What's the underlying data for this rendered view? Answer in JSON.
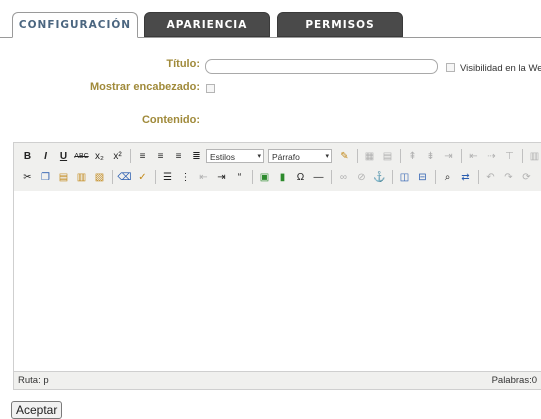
{
  "tabs": [
    {
      "label": "CONFIGURACIÓN",
      "active": true
    },
    {
      "label": "APARIENCIA",
      "active": false
    },
    {
      "label": "PERMISOS",
      "active": false
    }
  ],
  "form": {
    "title_label": "Título:",
    "title_value": "",
    "visibility_label": "Visibilidad en la Web",
    "show_header_label": "Mostrar encabezado:",
    "content_label": "Contenido:"
  },
  "editor": {
    "styles_select": "Estilos",
    "format_select": "Párrafo",
    "toolbar_row1": [
      "bold-icon",
      "italic-icon",
      "underline-icon",
      "strikethrough-icon",
      "subscript-icon",
      "superscript-icon",
      "align-left-icon",
      "align-center-icon",
      "align-right-icon",
      "align-justify-icon"
    ],
    "toolbar_row2": [
      "cut-icon",
      "copy-icon",
      "paste-icon",
      "paste-text-icon",
      "paste-word-icon",
      "clean-icon",
      "spellcheck-icon",
      "bullet-list-icon",
      "numbered-list-icon",
      "outdent-icon",
      "indent-icon",
      "blockquote-icon",
      "image-icon",
      "media-icon",
      "special-char-icon",
      "horizontal-rule-icon",
      "link-icon",
      "unlink-icon",
      "anchor-icon",
      "search-icon",
      "replace-icon",
      "undo-icon",
      "redo-icon",
      "help-icon"
    ],
    "path_label": "Ruta: p",
    "word_count": "Palabras:0"
  },
  "actions": {
    "accept_label": "Aceptar"
  },
  "colors": {
    "label": "#a08a3a",
    "tab_active_text": "#4b6680",
    "tab_inactive_bg": "#4a4a4a",
    "toolbar_bg": "#f0f0ee"
  }
}
